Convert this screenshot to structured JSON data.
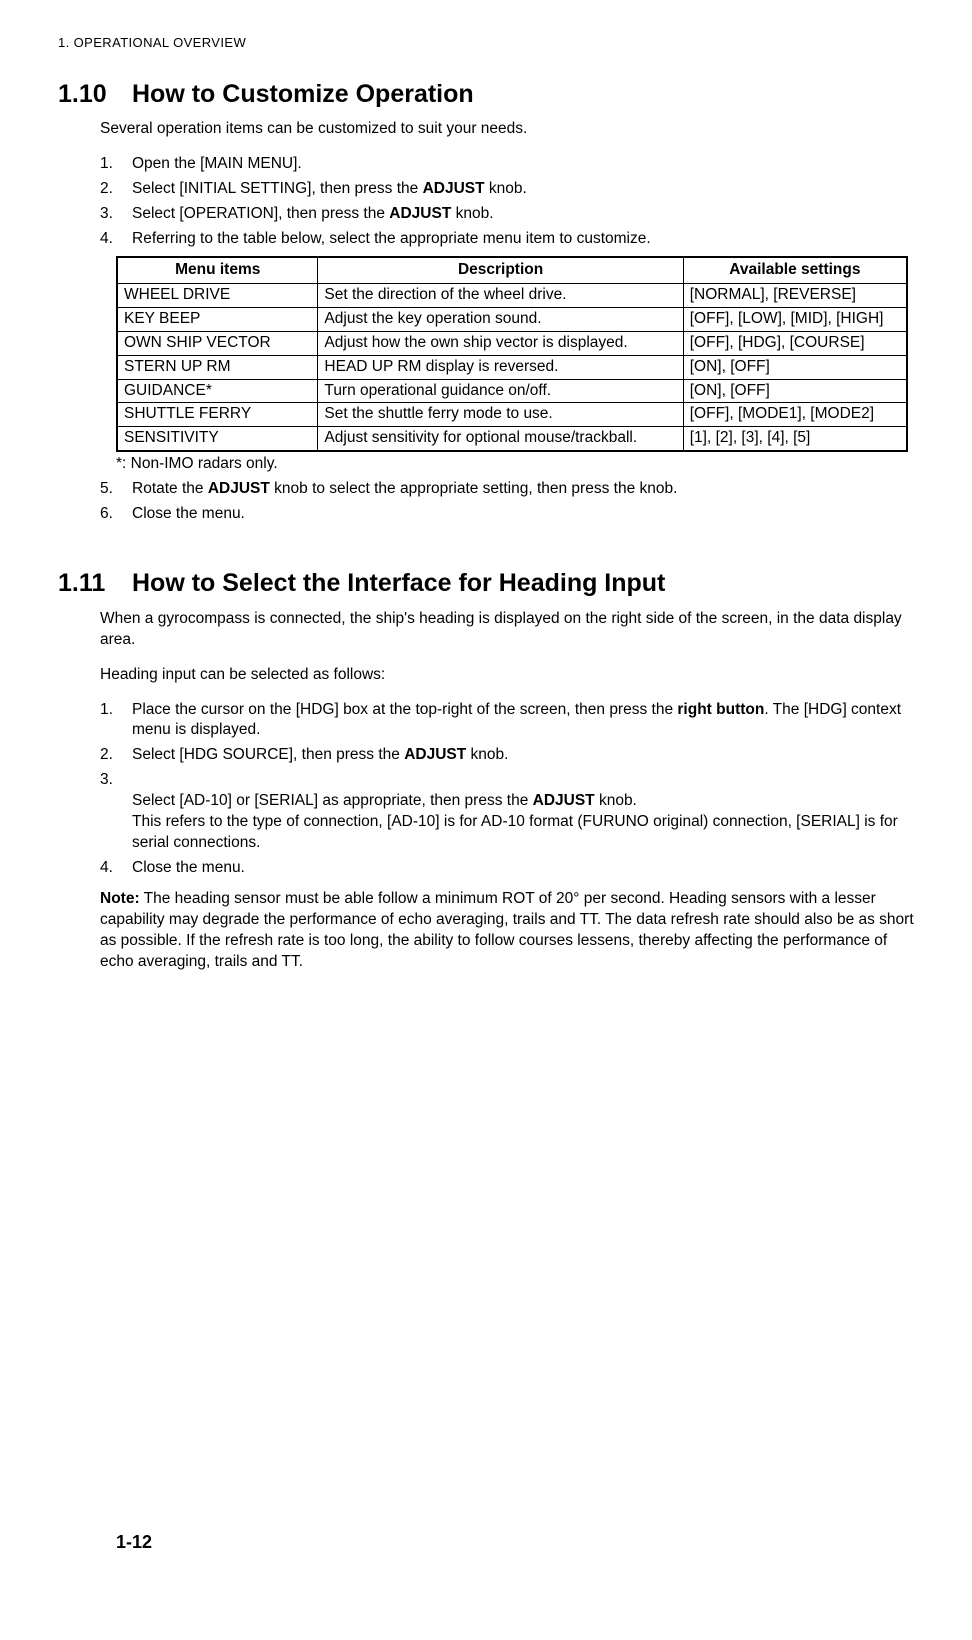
{
  "chapter_header": "1.  OPERATIONAL OVERVIEW",
  "section_1_10": {
    "number": "1.10",
    "title": "How to Customize Operation",
    "intro": "Several operation items can be customized to suit your needs.",
    "steps": {
      "s1": {
        "marker": "1.",
        "text": "Open the [MAIN MENU]."
      },
      "s2": {
        "marker": "2.",
        "text_a": "Select [INITIAL SETTING], then press the ",
        "bold": "ADJUST",
        "text_b": " knob."
      },
      "s3": {
        "marker": "3.",
        "text_a": "Select [OPERATION], then press the ",
        "bold": "ADJUST",
        "text_b": " knob."
      },
      "s4": {
        "marker": "4.",
        "text": "Referring to the table below, select the appropriate menu item to customize."
      },
      "s5": {
        "marker": "5.",
        "text_a": "Rotate the ",
        "bold": "ADJUST",
        "text_b": " knob to select the appropriate setting, then press the knob."
      },
      "s6": {
        "marker": "6.",
        "text": "Close the menu."
      }
    },
    "table": {
      "head": {
        "c1": "Menu items",
        "c2": "Description",
        "c3": "Available settings"
      },
      "rows": {
        "r0": {
          "c1": "WHEEL DRIVE",
          "c2": "Set the direction of the wheel drive.",
          "c3": "[NORMAL], [REVERSE]"
        },
        "r1": {
          "c1": "KEY BEEP",
          "c2": "Adjust the key operation sound.",
          "c3": "[OFF], [LOW], [MID], [HIGH]"
        },
        "r2": {
          "c1": "OWN SHIP VECTOR",
          "c2": "Adjust how the own ship vector is displayed.",
          "c3": "[OFF], [HDG], [COURSE]"
        },
        "r3": {
          "c1": "STERN UP RM",
          "c2": "HEAD UP RM display is reversed.",
          "c3": "[ON], [OFF]"
        },
        "r4": {
          "c1": "GUIDANCE*",
          "c2": "Turn operational guidance on/off.",
          "c3": "[ON], [OFF]"
        },
        "r5": {
          "c1": "SHUTTLE FERRY",
          "c2": "Set the shuttle ferry mode to use.",
          "c3": "[OFF], [MODE1], [MODE2]"
        },
        "r6": {
          "c1": "SENSITIVITY",
          "c2": "Adjust sensitivity for optional mouse/trackball.",
          "c3": "[1], [2], [3], [4], [5]"
        }
      }
    },
    "footnote": "*: Non-IMO radars only."
  },
  "section_1_11": {
    "number": "1.11",
    "title": "How to Select the Interface for Heading Input",
    "intro1": "When a gyrocompass is connected, the ship's heading is displayed on the right side of the screen, in the data display area.",
    "intro2": "Heading input can be selected as follows:",
    "steps": {
      "s1": {
        "marker": "1.",
        "text_a": "Place the cursor on the [HDG] box at the top-right of the screen, then press the ",
        "bold": "right button",
        "text_b": ". The [HDG] context menu is displayed."
      },
      "s2": {
        "marker": "2.",
        "text_a": "Select [HDG SOURCE], then press the ",
        "bold": "ADJUST",
        "text_b": " knob."
      },
      "s3": {
        "marker": "3.",
        "text_a": "Select [AD-10] or [SERIAL] as appropriate, then press the ",
        "bold": "ADJUST",
        "text_b": " knob.\nThis refers to the type of connection, [AD-10] is for AD-10 format (FURUNO original) connection, [SERIAL] is for serial connections."
      },
      "s4": {
        "marker": "4.",
        "text": "Close the menu."
      }
    },
    "note_label": "Note:",
    "note_text": " The heading sensor must be able follow a minimum ROT of 20° per second. Heading sensors with a lesser capability may degrade the performance of echo averaging, trails and TT. The data refresh rate should also be as short as possible. If the refresh rate is too long, the ability to follow courses lessens, thereby affecting the performance of echo averaging, trails and TT."
  },
  "page_num": "1-12"
}
